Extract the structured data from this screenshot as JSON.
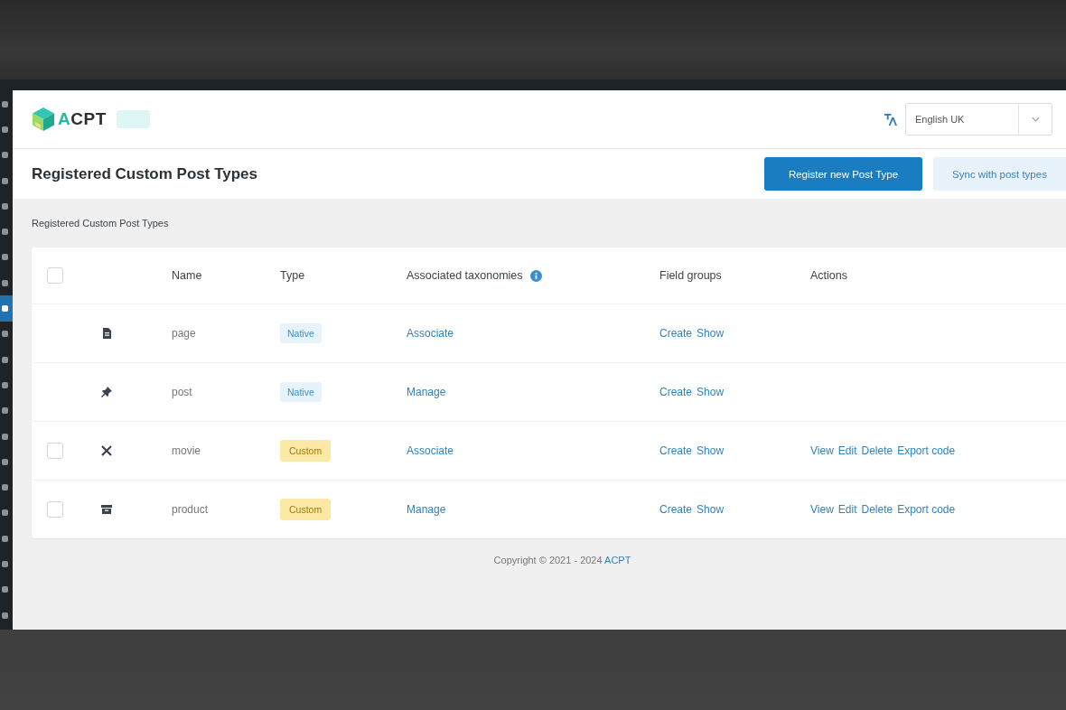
{
  "sidebar": {
    "items": [
      {
        "selected": false
      },
      {
        "selected": false
      },
      {
        "selected": false
      },
      {
        "selected": false
      },
      {
        "selected": false
      },
      {
        "selected": false
      },
      {
        "selected": false
      },
      {
        "selected": false
      },
      {
        "selected": true
      },
      {
        "selected": false
      },
      {
        "selected": false
      },
      {
        "selected": false
      },
      {
        "selected": false
      },
      {
        "selected": false
      },
      {
        "selected": false
      },
      {
        "selected": false
      },
      {
        "selected": false
      },
      {
        "selected": false
      },
      {
        "selected": false
      },
      {
        "selected": false
      },
      {
        "selected": false
      }
    ]
  },
  "header": {
    "logo": "ACPT",
    "language_select": {
      "value": "English UK"
    }
  },
  "page_header": {
    "title": "Registered Custom Post Types",
    "buttons": [
      {
        "label": "Register new Post Type",
        "kind": "primary"
      },
      {
        "label": "Sync with post types",
        "kind": "secondary"
      }
    ]
  },
  "breadcrumb": "Registered Custom Post Types",
  "table": {
    "select_all": {
      "checked": false
    },
    "columns": [
      {
        "label": "Name",
        "info": false
      },
      {
        "label": "Type",
        "info": false
      },
      {
        "label": "Associated taxonomies",
        "info": true
      },
      {
        "label": "Field groups",
        "info": false
      },
      {
        "label": "Actions",
        "info": false
      }
    ],
    "rows": [
      {
        "name": "page",
        "type": {
          "label": "Native",
          "kind": "native"
        },
        "taxonomies": "Associate",
        "field_groups": [
          "Create",
          "Show"
        ]
      },
      {
        "name": "post",
        "type": {
          "label": "Native",
          "kind": "native"
        },
        "taxonomies": "Manage",
        "field_groups": [
          "Create",
          "Show"
        ]
      },
      {
        "checkbox": {
          "checked": false
        },
        "name": "movie",
        "type": {
          "label": "Custom",
          "kind": "custom"
        },
        "taxonomies": "Associate",
        "field_groups": [
          "Create",
          "Show"
        ],
        "actions": [
          "View",
          "Edit",
          "Delete",
          "Export code"
        ]
      },
      {
        "checkbox": {
          "checked": false
        },
        "name": "product",
        "type": {
          "label": "Custom",
          "kind": "custom"
        },
        "taxonomies": "Manage",
        "field_groups": [
          "Create",
          "Show"
        ],
        "actions": [
          "View",
          "Edit",
          "Delete",
          "Export code"
        ]
      }
    ]
  },
  "footer": {
    "text": "Copyright © 2021 - 2024",
    "link": "ACPT"
  }
}
